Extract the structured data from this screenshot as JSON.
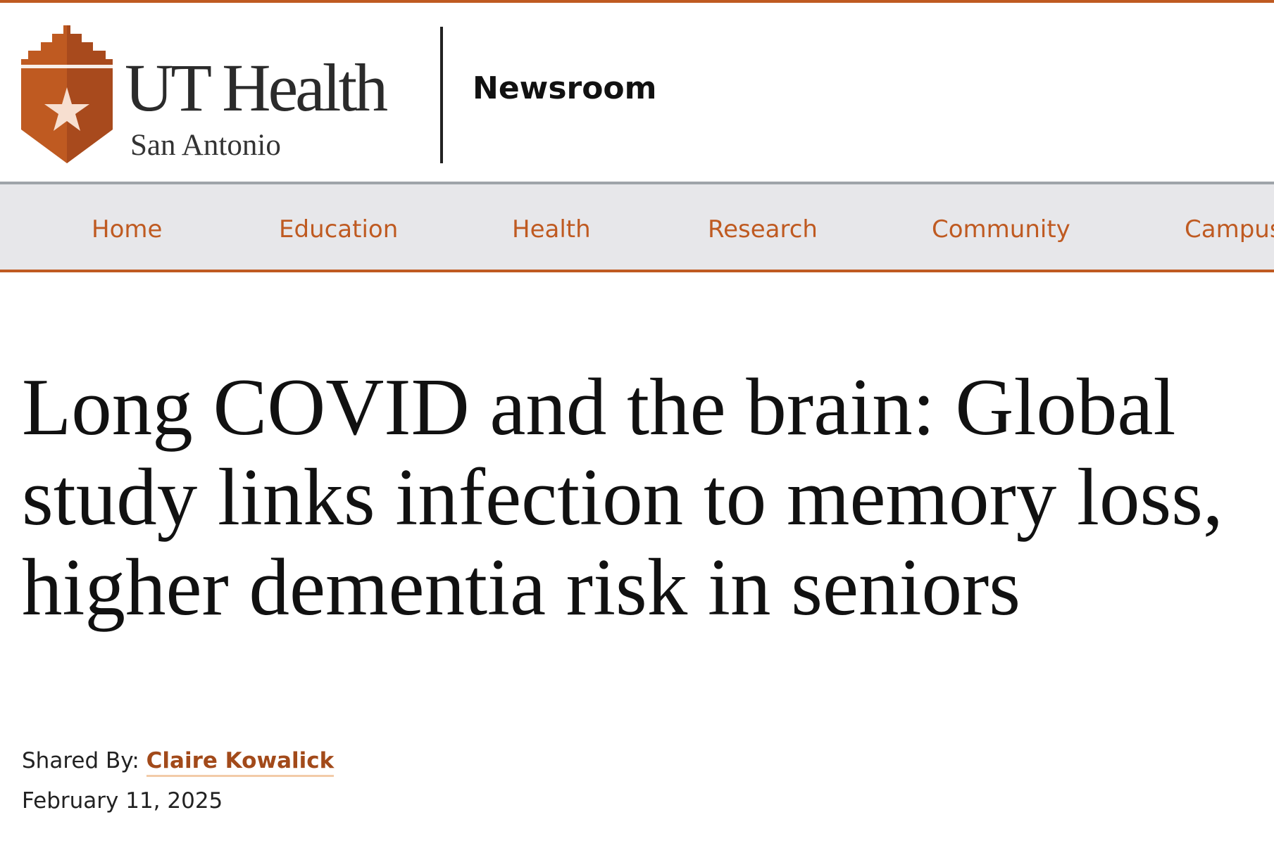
{
  "brand": {
    "name": "UT Health",
    "location": "San Antonio",
    "section": "Newsroom",
    "colors": {
      "orange": "#bf5a21",
      "shield_dark": "#a84a1d",
      "link": "#a24a1a",
      "nav_bg": "#e7e7ea"
    }
  },
  "nav": {
    "items": [
      {
        "label": "Home"
      },
      {
        "label": "Education"
      },
      {
        "label": "Health"
      },
      {
        "label": "Research"
      },
      {
        "label": "Community"
      },
      {
        "label": "Campus"
      }
    ]
  },
  "article": {
    "title": "Long COVID and the brain: Global study links infection to memory loss, higher dementia risk in seniors",
    "shared_by_label": "Shared By:",
    "author": "Claire Kowalick",
    "date": "February 11, 2025"
  }
}
